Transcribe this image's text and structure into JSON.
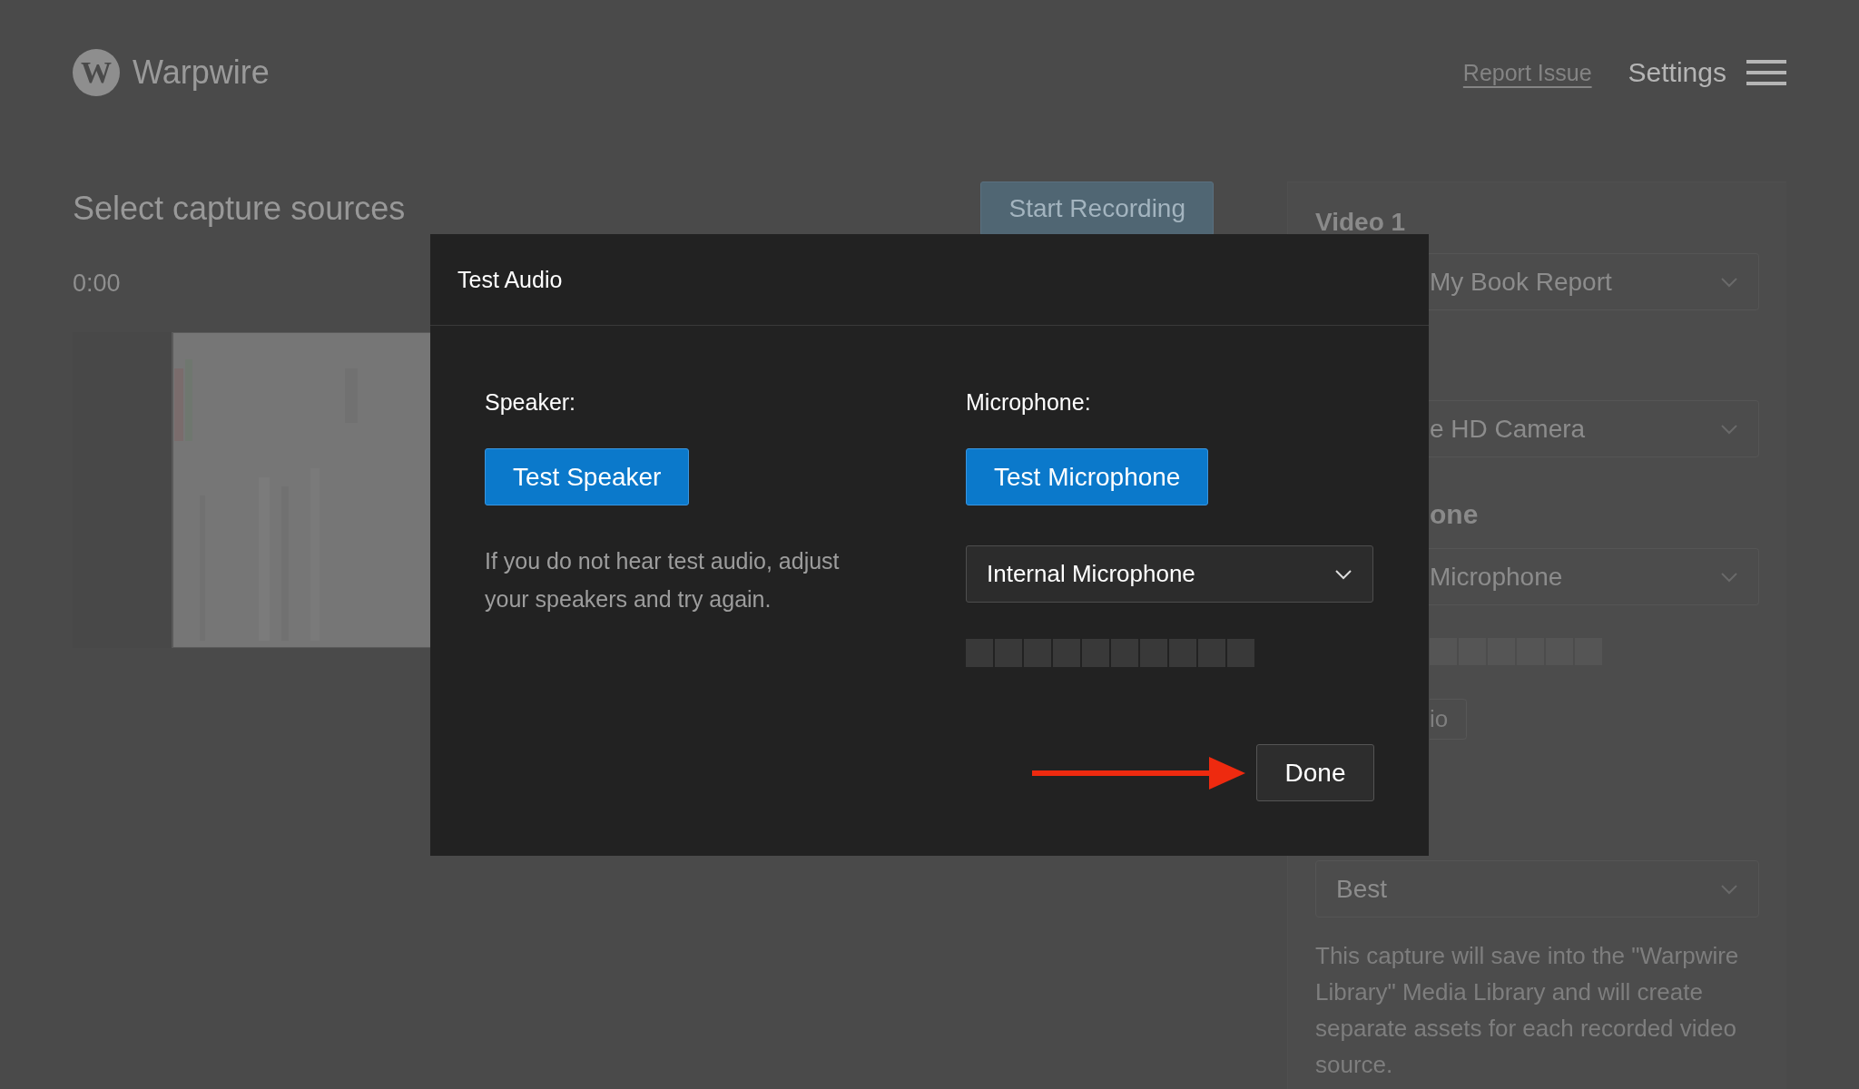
{
  "header": {
    "logo_letter": "W",
    "brand": "Warpwire",
    "report_link": "Report Issue",
    "settings": "Settings"
  },
  "capture": {
    "title": "Select capture sources",
    "start_button": "Start Recording",
    "timer": "0:00"
  },
  "sources_panel": {
    "heading": "Video 1",
    "items": [
      {
        "kind": "clipped",
        "value": "My Book Report"
      },
      {
        "kind": "clipped",
        "value": "e HD Camera"
      },
      {
        "kind": "heading",
        "text": "one"
      },
      {
        "kind": "clipped",
        "value": "Microphone"
      },
      {
        "kind": "meter",
        "level": 0
      },
      {
        "kind": "button",
        "label": "io"
      },
      {
        "kind": "select",
        "value": "Best"
      },
      {
        "kind": "note",
        "text": "This capture will save into the \"Warpwire Library\" Media Library and will create separate assets for each recorded video source."
      }
    ]
  },
  "dialog": {
    "title": "Test Audio",
    "speaker": {
      "label": "Speaker:",
      "button": "Test Speaker",
      "hint": "If you do not hear test audio, adjust your speakers and try again."
    },
    "microphone": {
      "label": "Microphone:",
      "button": "Test Microphone",
      "device": "Internal Microphone",
      "level": 0
    },
    "done_button": "Done"
  }
}
